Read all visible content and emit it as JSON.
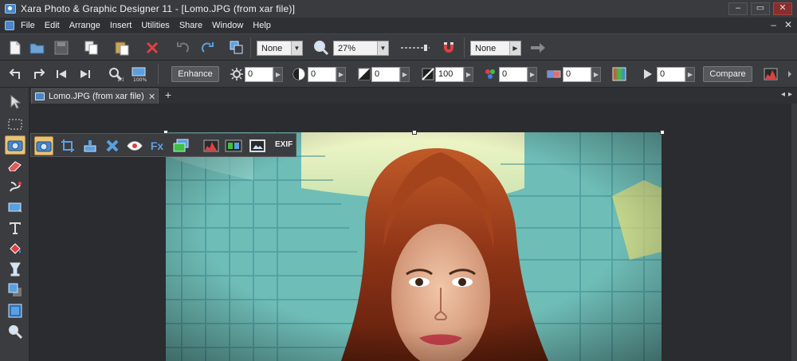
{
  "app": {
    "title": "Xara Photo & Graphic Designer 11 - [Lomo.JPG  (from xar file)]",
    "window_buttons": [
      "–",
      "▭",
      "✕"
    ],
    "icon": "xara-app-icon"
  },
  "menu": {
    "items": [
      "File",
      "Edit",
      "Arrange",
      "Insert",
      "Utilities",
      "Share",
      "Window",
      "Help"
    ],
    "right_controls": [
      "–",
      "✕"
    ]
  },
  "toolbar1": {
    "line_style": "None",
    "zoom": "27%",
    "fill_type": "None",
    "icons": [
      "new-file-icon",
      "open-file-icon",
      "save-icon",
      "copy-icon",
      "paste-icon",
      "delete-icon",
      "undo-icon",
      "redo-icon",
      "bring-front-icon",
      "zoom-icon",
      "line-width-icon",
      "magnet-icon",
      "arrow-right-icon"
    ]
  },
  "toolbar2": {
    "enhance_label": "Enhance",
    "compare_label": "Compare",
    "brightness": "0",
    "contrast": "0",
    "exposure": "0",
    "levels": "100",
    "saturation": "0",
    "temperature": "0",
    "sharpness": "0",
    "colors": {
      "accent": "#e9c27a",
      "delete": "#e04040"
    }
  },
  "tabs": [
    {
      "label": "Lomo.JPG  (from xar file)",
      "close": "✕"
    }
  ],
  "tab_add": "+",
  "photo_tools": {
    "exif_label": "EXIF",
    "fx_label": "Fx"
  },
  "nav_arrows": [
    "◂",
    "▸"
  ]
}
